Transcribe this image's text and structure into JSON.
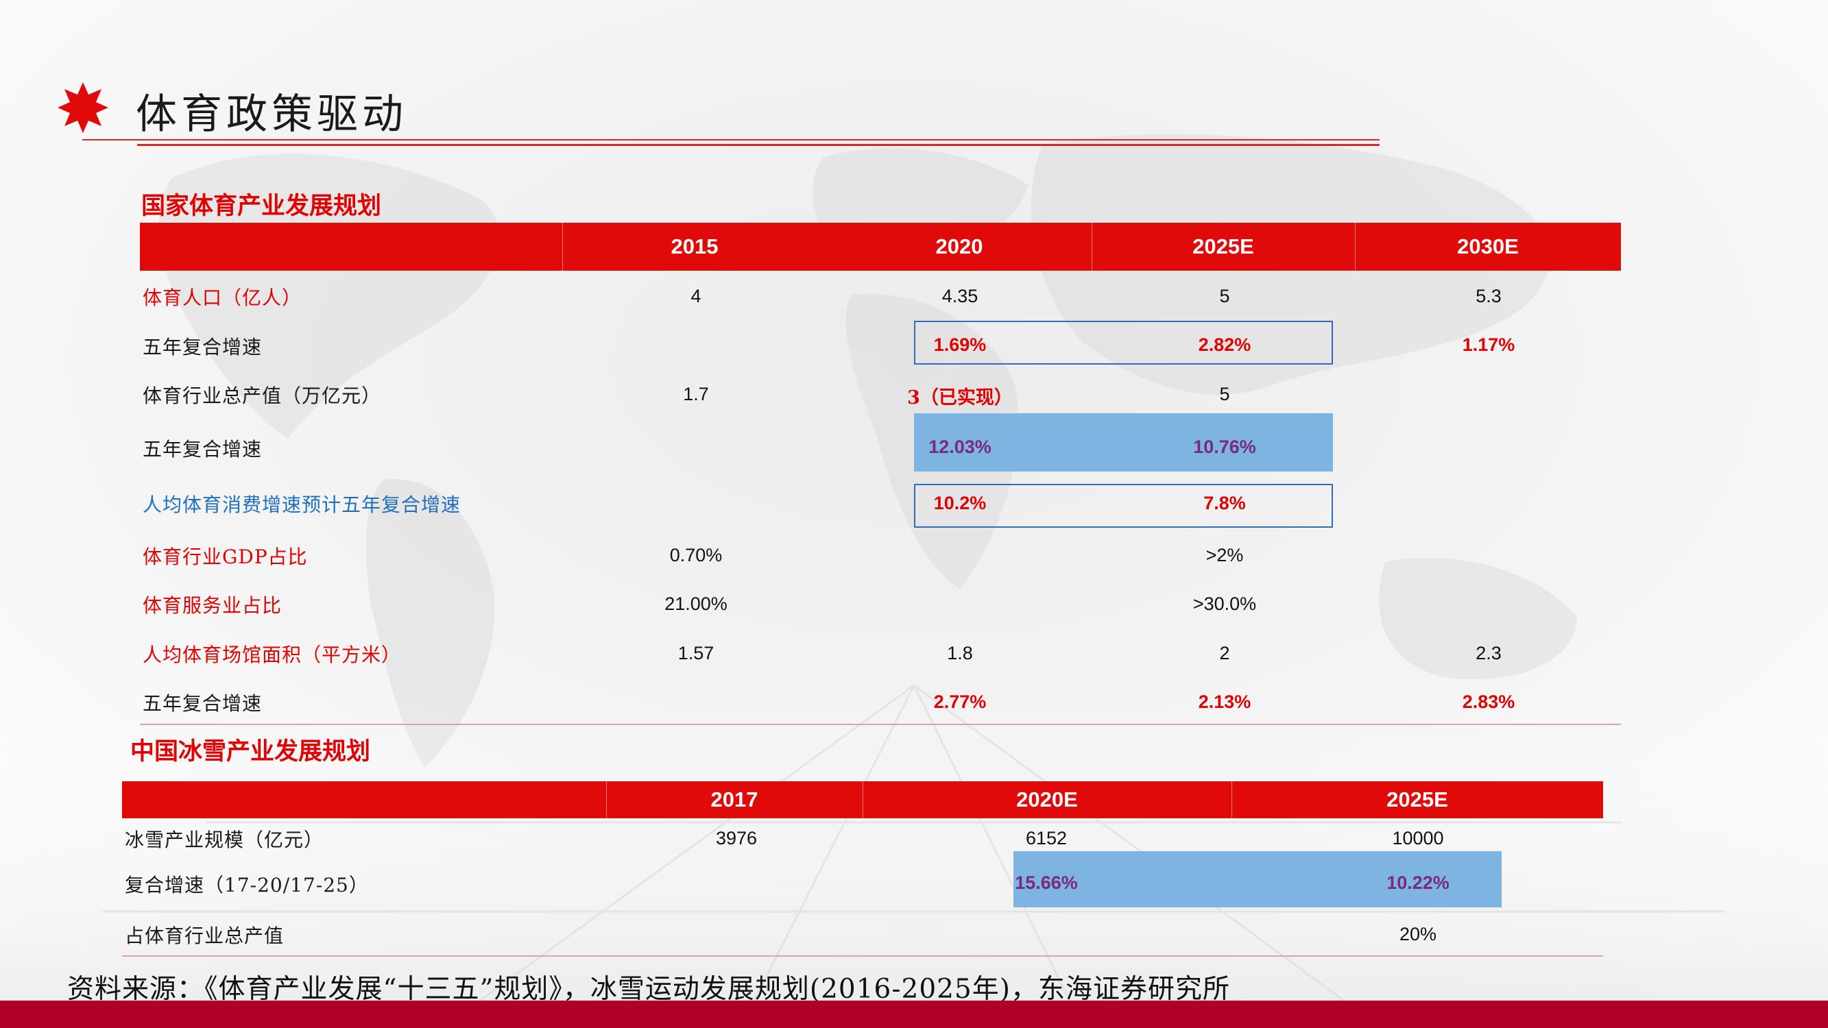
{
  "page_title": "体育政策驱动",
  "section1": {
    "title": "国家体育产业发展规划",
    "headers": [
      "2015",
      "2020",
      "2025E",
      "2030E"
    ],
    "rows": [
      {
        "label": "体育人口（亿人）",
        "values": [
          "4",
          "4.35",
          "5",
          "5.3"
        ]
      },
      {
        "label": "五年复合增速",
        "values": [
          "",
          "1.69%",
          "2.82%",
          "1.17%"
        ]
      },
      {
        "label": "体育行业总产值（万亿元）",
        "values": [
          "1.7",
          "3（已实现）",
          "5",
          ""
        ]
      },
      {
        "label": "五年复合增速",
        "values": [
          "",
          "12.03%",
          "10.76%",
          ""
        ]
      },
      {
        "label": "人均体育消费增速预计五年复合增速",
        "values": [
          "",
          "10.2%",
          "7.8%",
          ""
        ]
      },
      {
        "label": "体育行业GDP占比",
        "values": [
          "0.70%",
          "",
          ">2%",
          ""
        ]
      },
      {
        "label": "体育服务业占比",
        "values": [
          "21.00%",
          "",
          ">30.0%",
          ""
        ]
      },
      {
        "label": "人均体育场馆面积（平方米）",
        "values": [
          "1.57",
          "1.8",
          "2",
          "2.3"
        ]
      },
      {
        "label": "五年复合增速",
        "values": [
          "",
          "2.77%",
          "2.13%",
          "2.83%"
        ]
      }
    ]
  },
  "section2": {
    "title": "中国冰雪产业发展规划",
    "headers": [
      "2017",
      "2020E",
      "2025E"
    ],
    "rows": [
      {
        "label": "冰雪产业规模（亿元）",
        "values": [
          "3976",
          "6152",
          "10000"
        ]
      },
      {
        "label": "复合增速（17-20/17-25）",
        "values": [
          "",
          "15.66%",
          "10.22%"
        ]
      },
      {
        "label": "占体育行业总产值",
        "values": [
          "",
          "",
          "20%"
        ]
      }
    ]
  },
  "source": "资料来源：《体育产业发展“十三五”规划》，冰雪运动发展规划(2016-2025年)，东海证券研究所",
  "colors": {
    "accent_red": "#e00a0a",
    "bottom_bar": "#b0002a",
    "highlight_blue": "#7eb4e2",
    "outline_blue": "#2f6db5"
  }
}
